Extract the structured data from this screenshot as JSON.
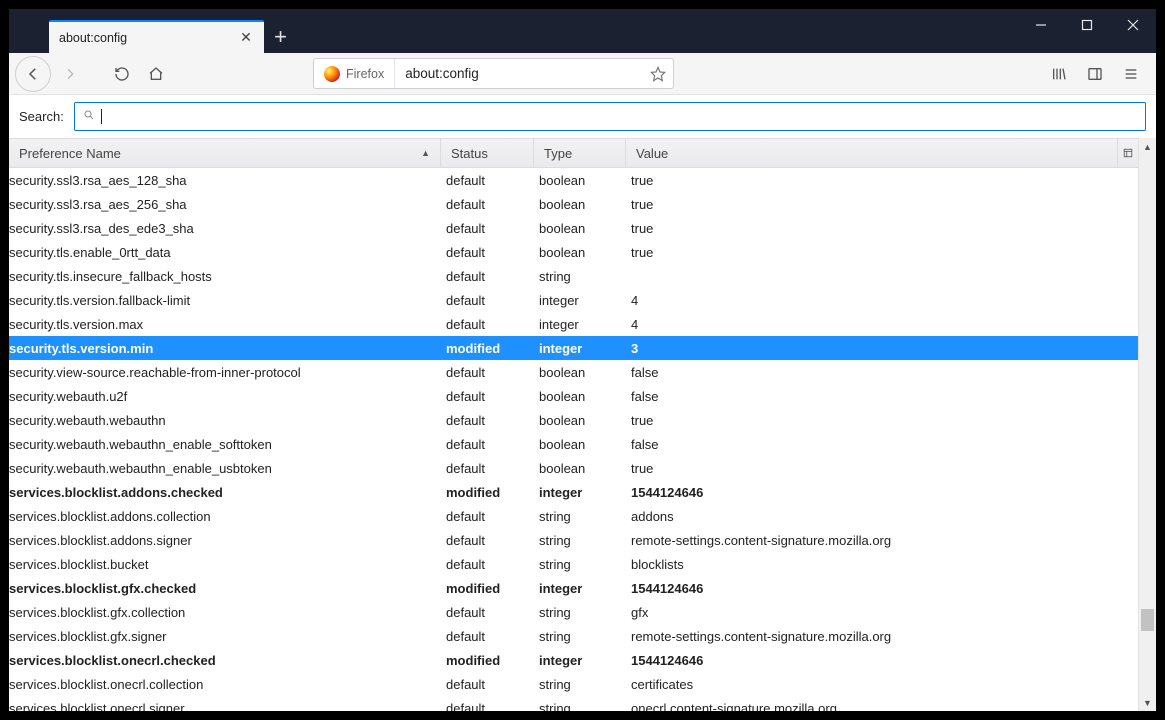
{
  "window": {
    "tab_title": "about:config"
  },
  "nav": {
    "identity": "Firefox",
    "url": "about:config"
  },
  "config": {
    "search_label": "Search:",
    "headers": {
      "name": "Preference Name",
      "status": "Status",
      "type": "Type",
      "value": "Value"
    },
    "rows": [
      {
        "name": "security.ssl3.rsa_aes_128_sha",
        "status": "default",
        "type": "boolean",
        "value": "true",
        "modified": false,
        "selected": false
      },
      {
        "name": "security.ssl3.rsa_aes_256_sha",
        "status": "default",
        "type": "boolean",
        "value": "true",
        "modified": false,
        "selected": false
      },
      {
        "name": "security.ssl3.rsa_des_ede3_sha",
        "status": "default",
        "type": "boolean",
        "value": "true",
        "modified": false,
        "selected": false
      },
      {
        "name": "security.tls.enable_0rtt_data",
        "status": "default",
        "type": "boolean",
        "value": "true",
        "modified": false,
        "selected": false
      },
      {
        "name": "security.tls.insecure_fallback_hosts",
        "status": "default",
        "type": "string",
        "value": "",
        "modified": false,
        "selected": false
      },
      {
        "name": "security.tls.version.fallback-limit",
        "status": "default",
        "type": "integer",
        "value": "4",
        "modified": false,
        "selected": false
      },
      {
        "name": "security.tls.version.max",
        "status": "default",
        "type": "integer",
        "value": "4",
        "modified": false,
        "selected": false
      },
      {
        "name": "security.tls.version.min",
        "status": "modified",
        "type": "integer",
        "value": "3",
        "modified": true,
        "selected": true
      },
      {
        "name": "security.view-source.reachable-from-inner-protocol",
        "status": "default",
        "type": "boolean",
        "value": "false",
        "modified": false,
        "selected": false
      },
      {
        "name": "security.webauth.u2f",
        "status": "default",
        "type": "boolean",
        "value": "false",
        "modified": false,
        "selected": false
      },
      {
        "name": "security.webauth.webauthn",
        "status": "default",
        "type": "boolean",
        "value": "true",
        "modified": false,
        "selected": false
      },
      {
        "name": "security.webauth.webauthn_enable_softtoken",
        "status": "default",
        "type": "boolean",
        "value": "false",
        "modified": false,
        "selected": false
      },
      {
        "name": "security.webauth.webauthn_enable_usbtoken",
        "status": "default",
        "type": "boolean",
        "value": "true",
        "modified": false,
        "selected": false
      },
      {
        "name": "services.blocklist.addons.checked",
        "status": "modified",
        "type": "integer",
        "value": "1544124646",
        "modified": true,
        "selected": false
      },
      {
        "name": "services.blocklist.addons.collection",
        "status": "default",
        "type": "string",
        "value": "addons",
        "modified": false,
        "selected": false
      },
      {
        "name": "services.blocklist.addons.signer",
        "status": "default",
        "type": "string",
        "value": "remote-settings.content-signature.mozilla.org",
        "modified": false,
        "selected": false
      },
      {
        "name": "services.blocklist.bucket",
        "status": "default",
        "type": "string",
        "value": "blocklists",
        "modified": false,
        "selected": false
      },
      {
        "name": "services.blocklist.gfx.checked",
        "status": "modified",
        "type": "integer",
        "value": "1544124646",
        "modified": true,
        "selected": false
      },
      {
        "name": "services.blocklist.gfx.collection",
        "status": "default",
        "type": "string",
        "value": "gfx",
        "modified": false,
        "selected": false
      },
      {
        "name": "services.blocklist.gfx.signer",
        "status": "default",
        "type": "string",
        "value": "remote-settings.content-signature.mozilla.org",
        "modified": false,
        "selected": false
      },
      {
        "name": "services.blocklist.onecrl.checked",
        "status": "modified",
        "type": "integer",
        "value": "1544124646",
        "modified": true,
        "selected": false
      },
      {
        "name": "services.blocklist.onecrl.collection",
        "status": "default",
        "type": "string",
        "value": "certificates",
        "modified": false,
        "selected": false
      },
      {
        "name": "services.blocklist.onecrl.signer",
        "status": "default",
        "type": "string",
        "value": "onecrl.content-signature.mozilla.org",
        "modified": false,
        "selected": false
      }
    ]
  }
}
